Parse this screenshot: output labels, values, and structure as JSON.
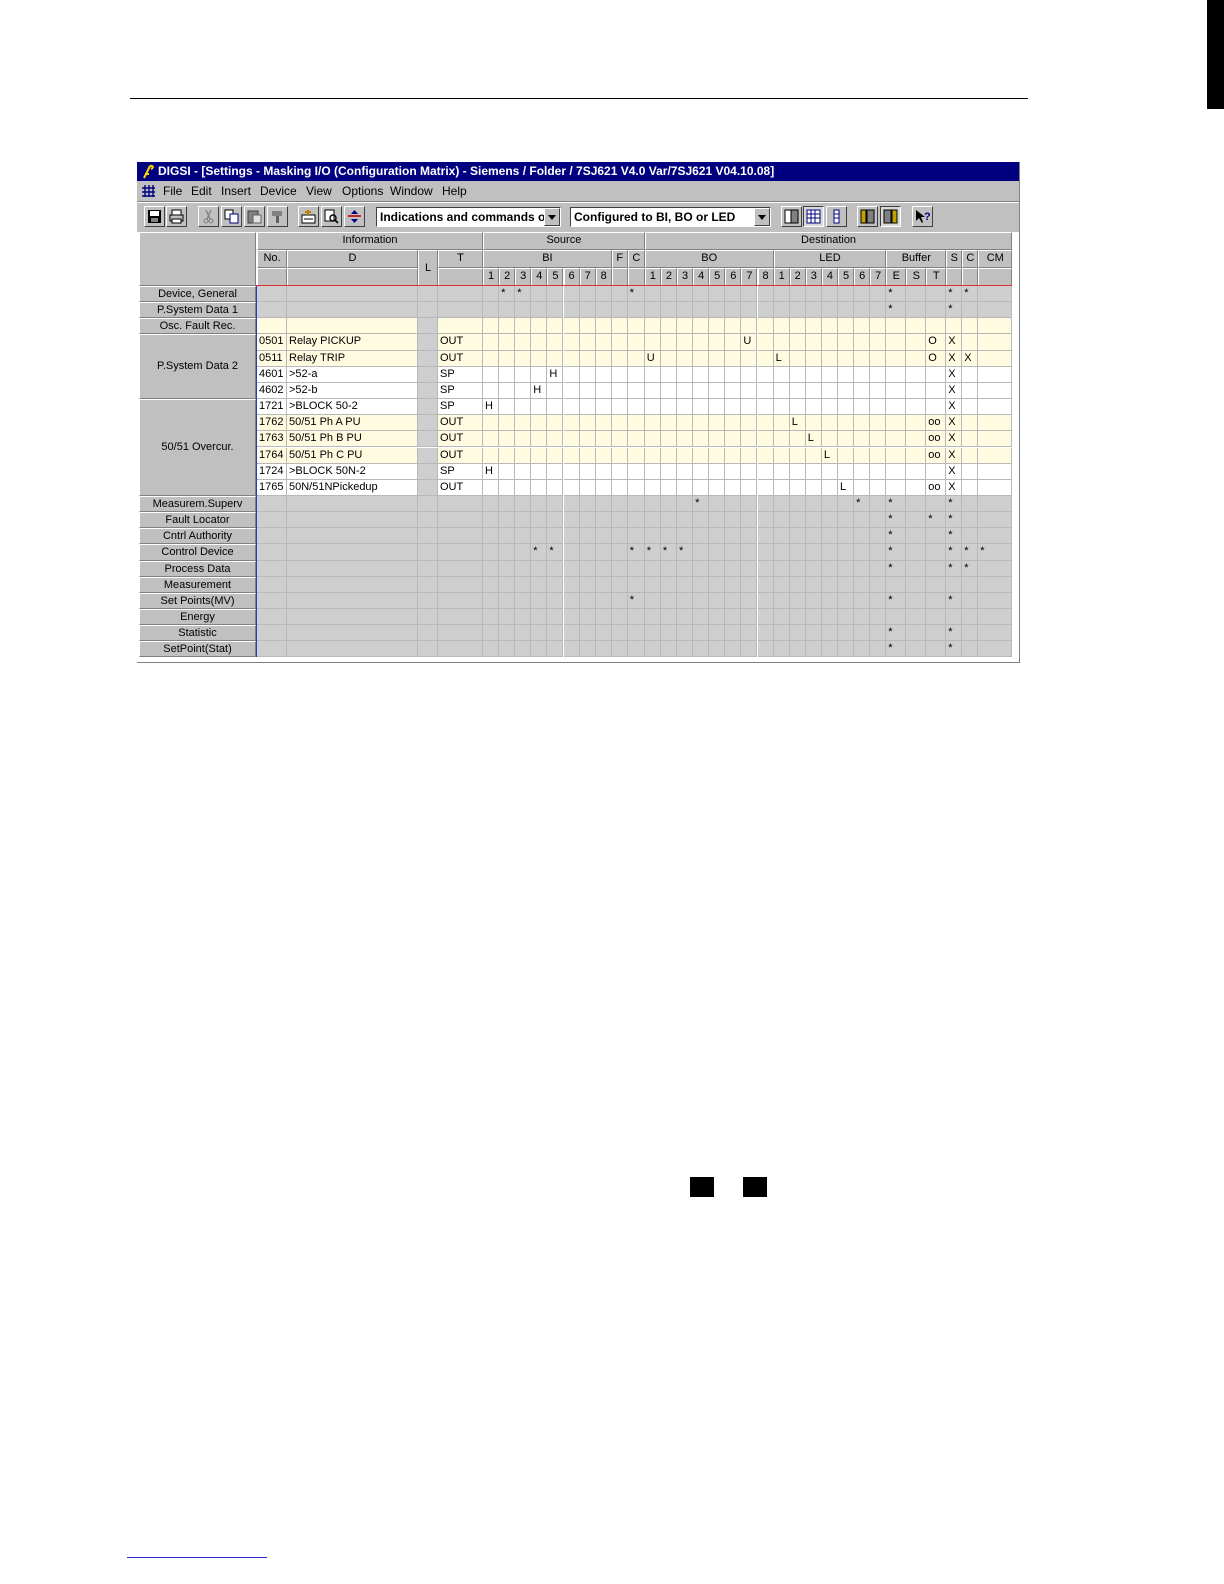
{
  "window": {
    "title": "DIGSI - [Settings - Masking I/O (Configuration Matrix) - Siemens / Folder / 7SJ621 V4.0 Var/7SJ621 V04.10.08]"
  },
  "menu": [
    "File",
    "Edit",
    "Insert",
    "Device",
    "View",
    "Options",
    "Window",
    "Help"
  ],
  "toolbar": {
    "filter_info": "Indications and commands o",
    "filter_config": "Configured to BI, BO or LED",
    "icons": [
      "save-icon",
      "print-icon",
      "cut-icon",
      "copy-icon",
      "paste-icon",
      "format-painter-icon",
      "insert-icon",
      "search-icon",
      "expand-icon",
      "standard-view-icon",
      "grid-view-icon",
      "short-view-icon",
      "source-columns-icon",
      "destination-columns-icon",
      "help-icon"
    ]
  },
  "headers": {
    "information": "Information",
    "source": "Source",
    "destination": "Destination",
    "no": "No.",
    "d": "D",
    "l": "L",
    "t": "T",
    "bi": "BI",
    "f": "F",
    "c": "C",
    "bo": "BO",
    "led": "LED",
    "buffer": "Buffer",
    "s": "S",
    "c2": "C",
    "cm": "CM",
    "bi_nums": [
      "1",
      "2",
      "3",
      "4",
      "5",
      "6",
      "7",
      "8"
    ],
    "bo_nums": [
      "1",
      "2",
      "3",
      "4",
      "5",
      "6",
      "7",
      "8"
    ],
    "led_nums": [
      "1",
      "2",
      "3",
      "4",
      "5",
      "6",
      "7"
    ],
    "buffer_sub": [
      "E",
      "S",
      "T"
    ]
  },
  "groups": [
    {
      "label": "Device, General",
      "rows": [
        {
          "empty": true,
          "marks": {
            "bi2": "*",
            "bi3": "*",
            "C": "*",
            "E": "*",
            "S2": "*",
            "C2": "*"
          }
        }
      ]
    },
    {
      "label": "P.System Data 1",
      "rows": [
        {
          "empty": true,
          "marks": {
            "E": "*",
            "S2": "*"
          }
        }
      ]
    },
    {
      "label": "Osc. Fault Rec.",
      "rows": [
        {
          "empty": true,
          "bg": "yel",
          "marks": {}
        }
      ]
    },
    {
      "label": "P.System Data 2",
      "rows": [
        {
          "no": "0501",
          "d": "Relay PICKUP",
          "t": "OUT",
          "bg": "yel",
          "marks": {
            "bo7": "U",
            "T": "O",
            "S2": "X"
          }
        },
        {
          "no": "0511",
          "d": "Relay TRIP",
          "t": "OUT",
          "bg": "yel",
          "marks": {
            "bo1": "U",
            "led1": "L",
            "T": "O",
            "S2": "X",
            "C2": "X"
          }
        },
        {
          "no": "4601",
          "d": ">52-a",
          "t": "SP",
          "bg": "white",
          "marks": {
            "bi5": "H",
            "S2": "X"
          }
        },
        {
          "no": "4602",
          "d": ">52-b",
          "t": "SP",
          "bg": "white",
          "marks": {
            "bi4": "H",
            "S2": "X"
          }
        }
      ]
    },
    {
      "label": "50/51 Overcur.",
      "rows": [
        {
          "no": "1721",
          "d": ">BLOCK 50-2",
          "t": "SP",
          "bg": "white",
          "marks": {
            "bi1": "H",
            "S2": "X"
          }
        },
        {
          "no": "1762",
          "d": "50/51 Ph A PU",
          "t": "OUT",
          "bg": "yel",
          "marks": {
            "led2": "L",
            "T": "oo",
            "S2": "X"
          }
        },
        {
          "no": "1763",
          "d": "50/51 Ph B PU",
          "t": "OUT",
          "bg": "yel",
          "marks": {
            "led3": "L",
            "T": "oo",
            "S2": "X"
          }
        },
        {
          "no": "1764",
          "d": "50/51 Ph C PU",
          "t": "OUT",
          "bg": "yel",
          "marks": {
            "led4": "L",
            "T": "oo",
            "S2": "X"
          }
        },
        {
          "no": "1724",
          "d": ">BLOCK 50N-2",
          "t": "SP",
          "bg": "white",
          "marks": {
            "bi1": "H",
            "S2": "X"
          }
        },
        {
          "no": "1765",
          "d": "50N/51NPickedup",
          "t": "OUT",
          "bg": "white",
          "marks": {
            "led5": "L",
            "T": "oo",
            "S2": "X"
          }
        }
      ]
    },
    {
      "label": "Measurem.Superv",
      "rows": [
        {
          "empty": true,
          "marks": {
            "bo4": "*",
            "led6": "*",
            "E": "*",
            "S2": "*"
          }
        }
      ]
    },
    {
      "label": "Fault Locator",
      "rows": [
        {
          "empty": true,
          "marks": {
            "E": "*",
            "T": "*",
            "S2": "*"
          }
        }
      ]
    },
    {
      "label": "Cntrl Authority",
      "rows": [
        {
          "empty": true,
          "marks": {
            "E": "*",
            "S2": "*"
          }
        }
      ]
    },
    {
      "label": "Control Device",
      "rows": [
        {
          "empty": true,
          "marks": {
            "bi4": "*",
            "bi5": "*",
            "C": "*",
            "bo1": "*",
            "bo2": "*",
            "bo3": "*",
            "E": "*",
            "S2": "*",
            "C2": "*",
            "CM": "*"
          }
        }
      ]
    },
    {
      "label": "Process Data",
      "rows": [
        {
          "empty": true,
          "marks": {
            "E": "*",
            "S2": "*",
            "C2": "*"
          }
        }
      ]
    },
    {
      "label": "Measurement",
      "rows": [
        {
          "empty": true,
          "marks": {}
        }
      ]
    },
    {
      "label": "Set Points(MV)",
      "rows": [
        {
          "empty": true,
          "marks": {
            "C": "*",
            "E": "*",
            "S2": "*"
          }
        }
      ]
    },
    {
      "label": "Energy",
      "rows": [
        {
          "empty": true,
          "marks": {}
        }
      ]
    },
    {
      "label": "Statistic",
      "rows": [
        {
          "empty": true,
          "marks": {
            "E": "*",
            "S2": "*"
          }
        }
      ]
    },
    {
      "label": "SetPoint(Stat)",
      "rows": [
        {
          "empty": true,
          "marks": {
            "E": "*",
            "S2": "*"
          }
        }
      ]
    }
  ]
}
